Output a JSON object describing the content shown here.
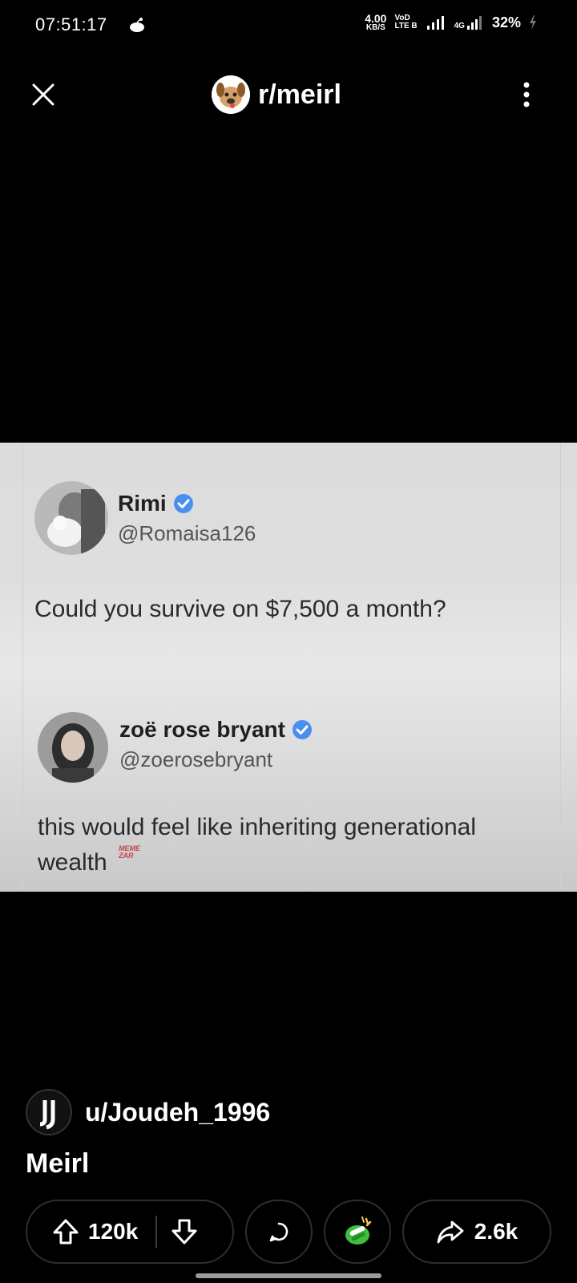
{
  "status_bar": {
    "time": "07:51:17",
    "net_speed_value": "4.00",
    "net_speed_unit": "KB/S",
    "volte_top": "VoD",
    "volte_bottom": "LTE B",
    "signal2_label": "4G",
    "battery": "32%"
  },
  "header": {
    "subreddit": "r/meirl"
  },
  "tweet": {
    "author1_name": "Rimi",
    "author1_handle": "@Romaisa126",
    "text1": "Could you survive on $7,500 a month?",
    "author2_name": "zoë rose bryant",
    "author2_handle": "@zoerosebryant",
    "text2_line1": "this would feel like inheriting generational",
    "text2_line2": "wealth",
    "watermark_top": "MEME",
    "watermark_bottom": "ZAR"
  },
  "post": {
    "author": "u/Joudeh_1996",
    "title": "Meirl"
  },
  "actions": {
    "upvotes": "120k",
    "shares": "2.6k"
  },
  "colors": {
    "background": "#000000",
    "verified_blue": "#4a8ef0",
    "award_green": "#3fbf3f"
  }
}
